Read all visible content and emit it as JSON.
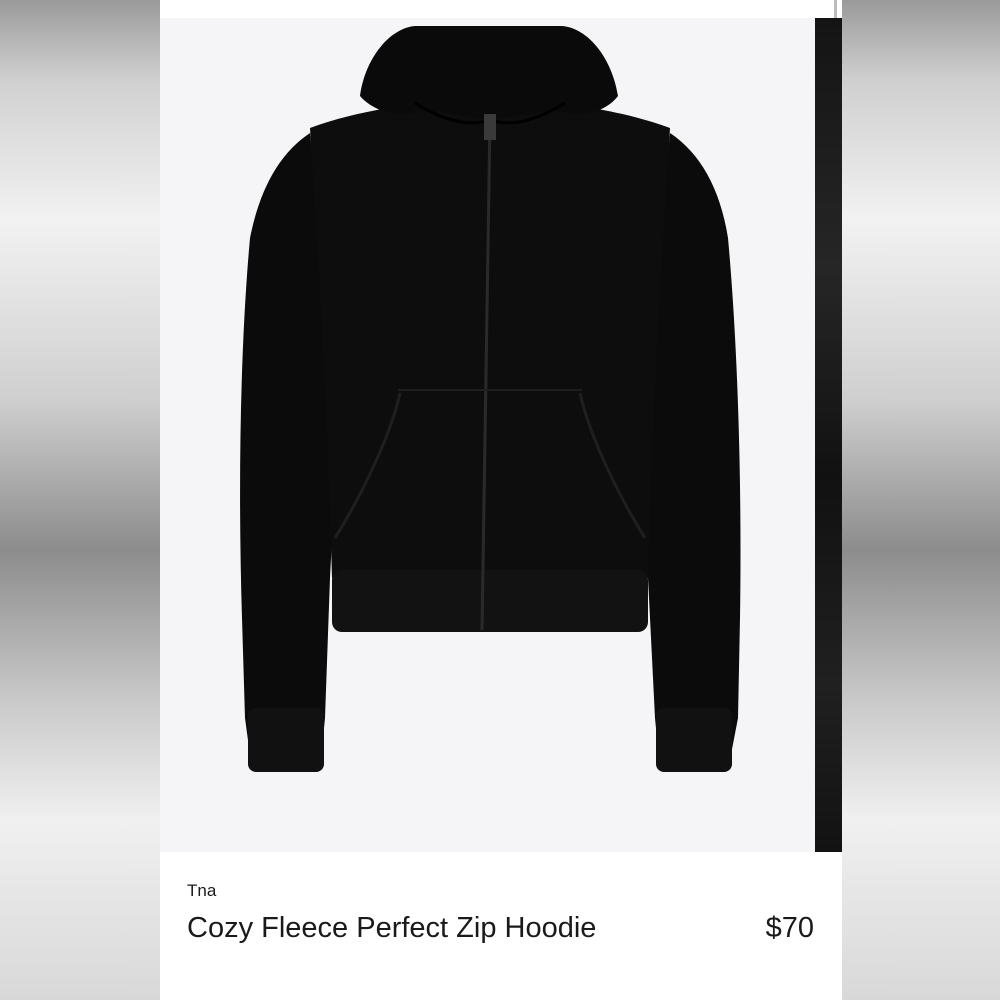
{
  "product": {
    "brand": "Tna",
    "title": "Cozy Fleece Perfect Zip Hoodie",
    "price": "$70"
  },
  "colors": {
    "garment": "#0c0c0c",
    "image_background": "#f5f5f7",
    "text": "#1a1a1a"
  }
}
